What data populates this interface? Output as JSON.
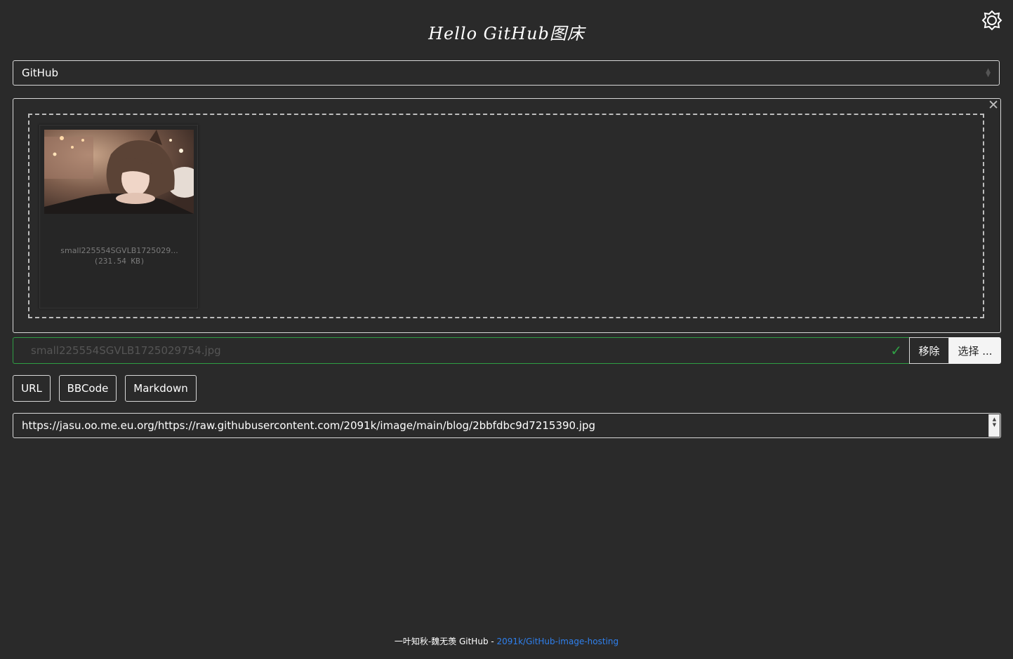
{
  "header": {
    "title": "Hello GitHub图床"
  },
  "theme_toggle": {
    "icon": "sun-gear-icon"
  },
  "provider_select": {
    "value": "GitHub"
  },
  "upload": {
    "close_icon": "close-icon",
    "file": {
      "name": "small225554SGVLB1725029...",
      "size": "(231.54 KB)"
    }
  },
  "file_input": {
    "value": "small225554SGVLB1725029754.jpg",
    "status_icon": "check-icon",
    "remove_label": "移除",
    "choose_label": "选择 ..."
  },
  "format_buttons": {
    "url": "URL",
    "bbcode": "BBCode",
    "markdown": "Markdown"
  },
  "result": {
    "value": "https://jasu.oo.me.eu.org/https://raw.githubusercontent.com/2091k/image/main/blog/2bbfdbc9d7215390.jpg"
  },
  "footer": {
    "text": "一叶知秋-魏无羡 GitHub - ",
    "link": "2091k/GitHub-image-hosting"
  },
  "colors": {
    "background": "#2a2a2a",
    "success": "#2f9e44",
    "link": "#2f80ed",
    "border": "#d8d8d8"
  }
}
